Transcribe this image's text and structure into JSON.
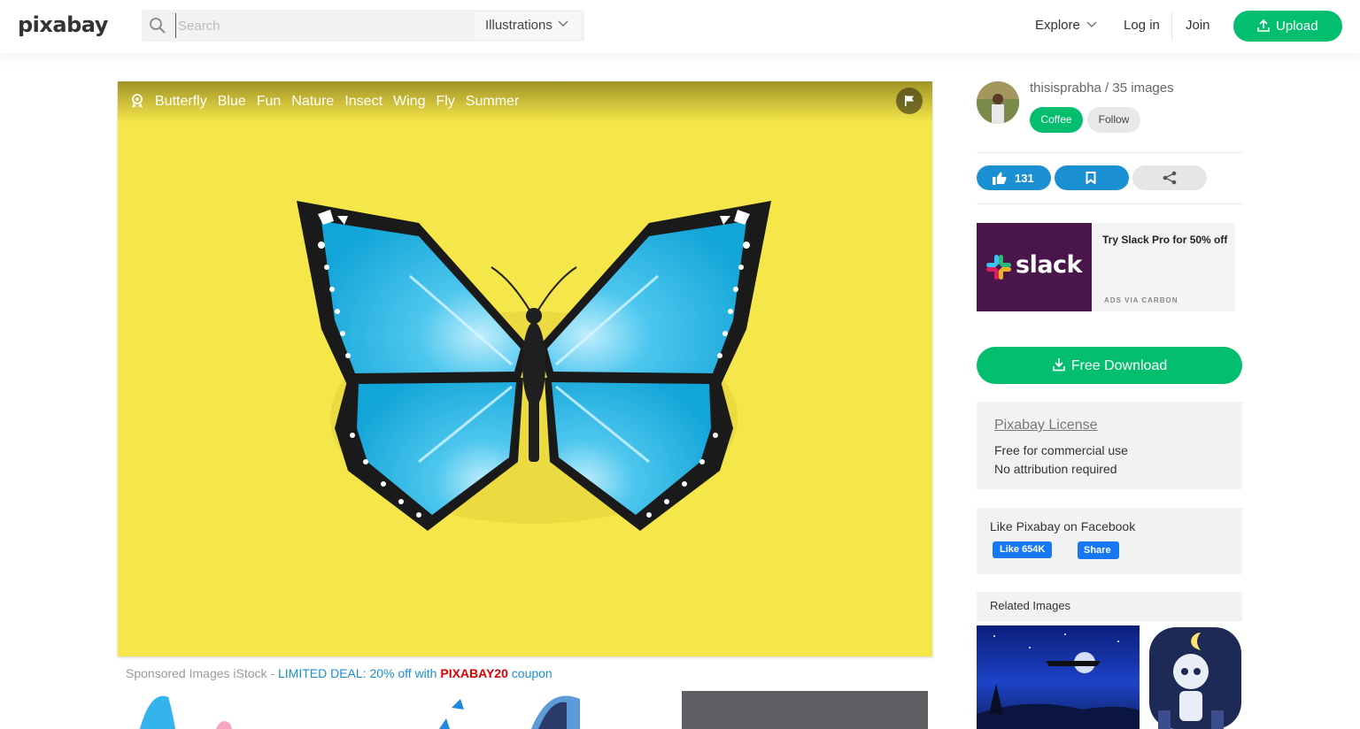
{
  "header": {
    "logo": "pixabay",
    "search_placeholder": "Search",
    "search_type": "Illustrations",
    "explore": "Explore",
    "login": "Log in",
    "join": "Join",
    "upload": "Upload"
  },
  "image": {
    "tags": [
      "Butterfly",
      "Blue",
      "Fun",
      "Nature",
      "Insect",
      "Wing",
      "Fly",
      "Summer"
    ]
  },
  "sponsored": {
    "prefix": "Sponsored Images iStock - ",
    "deal": "LIMITED DEAL: 20% off with ",
    "code": "PIXABAY20",
    "suffix": " coupon"
  },
  "sidebar": {
    "user": "thisisprabha / 35 images",
    "coffee": "Coffee",
    "follow": "Follow",
    "likes": "131",
    "ad": {
      "logo": "slack",
      "text": "Try Slack Pro for 50% off",
      "via": "ADS VIA CARBON"
    },
    "download": "Free Download",
    "license": {
      "title": "Pixabay License",
      "line1": "Free for commercial use",
      "line2": "No attribution required"
    },
    "facebook": {
      "title": "Like Pixabay on Facebook",
      "like": "Like 654K",
      "share": "Share"
    },
    "related": "Related Images"
  },
  "colors": {
    "green": "#02be6e",
    "blue": "#1a8fd1",
    "image_bg": "#f5e64a",
    "butterfly_wing": "#1eb0e0"
  }
}
